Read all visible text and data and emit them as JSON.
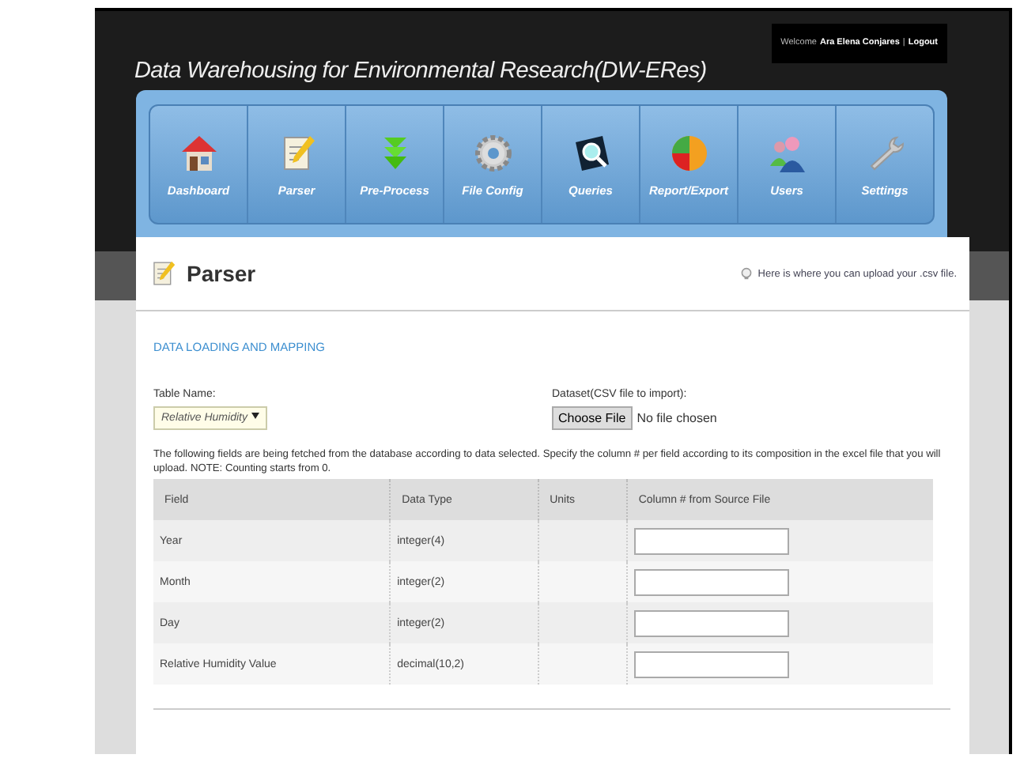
{
  "header": {
    "title": "Data Warehousing for Environmental Research(DW-ERes)",
    "welcome": "Welcome",
    "user": "Ara Elena Conjares",
    "separator": "|",
    "logout": "Logout"
  },
  "nav": [
    {
      "label": "Dashboard",
      "kind": "house"
    },
    {
      "label": "Parser",
      "kind": "notepad"
    },
    {
      "label": "Pre-Process",
      "kind": "arrows"
    },
    {
      "label": "File Config",
      "kind": "gear"
    },
    {
      "label": "Queries",
      "kind": "magnifier"
    },
    {
      "label": "Report/Export",
      "kind": "pie"
    },
    {
      "label": "Users",
      "kind": "people"
    },
    {
      "label": "Settings",
      "kind": "wrench"
    }
  ],
  "page": {
    "title": "Parser",
    "hint": "Here is where you can upload your .csv file."
  },
  "section": {
    "title": "DATA LOADING AND MAPPING",
    "table_name": {
      "label": "Table Name:",
      "value": "Relative Humidity"
    },
    "dataset": {
      "label": "Dataset(CSV file to import):",
      "button": "Choose File",
      "status": "No file chosen"
    },
    "note": "The following fields are being fetched from the database according to data selected. Specify the column # per field according to its composition in the excel file that you will upload. NOTE: Counting starts from 0.",
    "table": {
      "columns": [
        "Field",
        "Data Type",
        "Units",
        "Column # from Source File"
      ],
      "rows": [
        {
          "field": "Year",
          "data_type": "integer(4)"
        },
        {
          "field": "Month",
          "data_type": "integer(2)"
        },
        {
          "field": "Day",
          "data_type": "integer(2)"
        },
        {
          "field": "Relative Humidity Value",
          "data_type": "decimal(10,2)"
        }
      ]
    }
  }
}
